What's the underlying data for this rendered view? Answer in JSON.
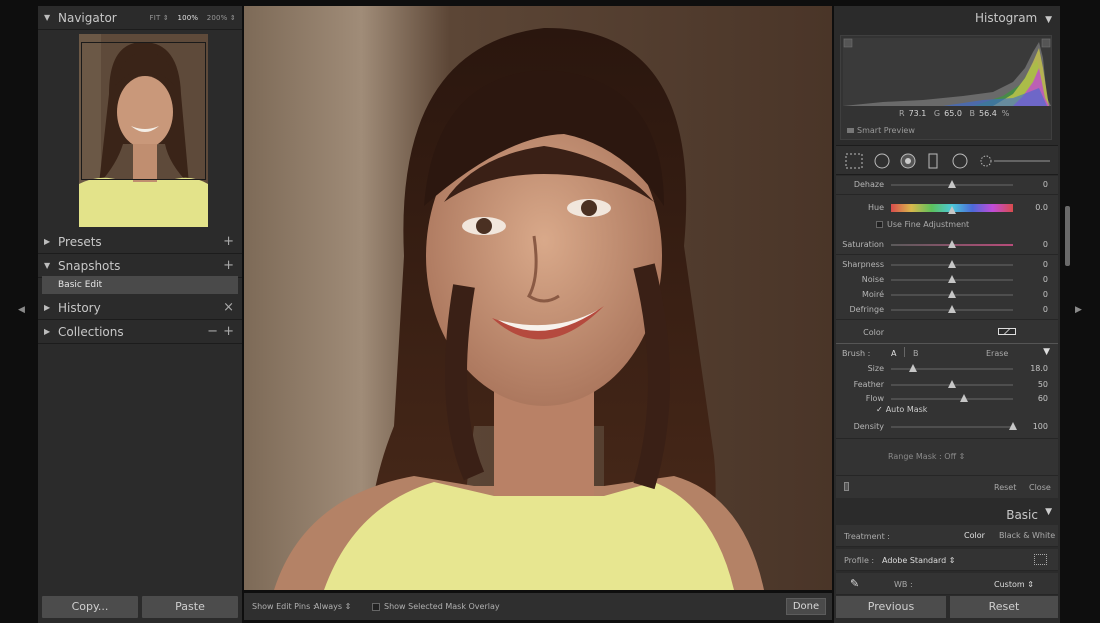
{
  "left_panel": {
    "navigator": {
      "title": "Navigator",
      "zoom_fit": "FIT ⇕",
      "zoom_100": "100%",
      "zoom_200": "200% ⇕"
    },
    "presets": {
      "title": "Presets"
    },
    "snapshots": {
      "title": "Snapshots",
      "item": "Basic Edit"
    },
    "history": {
      "title": "History"
    },
    "collections": {
      "title": "Collections"
    },
    "copy_label": "Copy...",
    "paste_label": "Paste"
  },
  "toolbar": {
    "edit_pins_label": "Show Edit Pins :",
    "edit_pins_value": "Always ⇕",
    "mask_overlay_label": "Show Selected Mask Overlay",
    "done_label": "Done"
  },
  "histogram": {
    "title": "Histogram",
    "r_label": "R",
    "r_value": "73.1",
    "g_label": "G",
    "g_value": "65.0",
    "b_label": "B",
    "b_value": "56.4",
    "unit": "%",
    "smart_preview": "Smart Preview"
  },
  "mask": {
    "dehaze": {
      "label": "Dehaze",
      "value": "0",
      "level": 0.5
    },
    "hue": {
      "label": "Hue",
      "value": "0.0",
      "level": 0.5
    },
    "fine_adjust": "Use Fine Adjustment",
    "saturation": {
      "label": "Saturation",
      "value": "0",
      "level": 0.5
    },
    "sharpness": {
      "label": "Sharpness",
      "value": "0",
      "level": 0.5
    },
    "noise": {
      "label": "Noise",
      "value": "0",
      "level": 0.5
    },
    "moire": {
      "label": "Moiré",
      "value": "0",
      "level": 0.5
    },
    "defringe": {
      "label": "Defringe",
      "value": "0",
      "level": 0.5
    },
    "color_label": "Color",
    "brush_label": "Brush :",
    "brush_a": "A",
    "brush_b": "B",
    "erase": "Erase",
    "size": {
      "label": "Size",
      "value": "18.0",
      "level": 0.18
    },
    "feather": {
      "label": "Feather",
      "value": "50",
      "level": 0.5
    },
    "flow": {
      "label": "Flow",
      "value": "60",
      "level": 0.6
    },
    "auto_mask": "Auto Mask",
    "density": {
      "label": "Density",
      "value": "100",
      "level": 1.0
    },
    "range_mask": "Range Mask : Off ⇕",
    "reset": "Reset",
    "close": "Close"
  },
  "basic": {
    "title": "Basic",
    "treatment_label": "Treatment :",
    "treatment_color": "Color",
    "treatment_bw": "Black & White",
    "profile_label": "Profile :",
    "profile_value": "Adobe Standard ⇕",
    "wb_label": "WB :",
    "wb_value": "Custom ⇕"
  },
  "bottom": {
    "previous_label": "Previous",
    "reset_label": "Reset"
  },
  "colors": {
    "panel_bg": "#2b2b2b",
    "window_bg": "#0e0e0e",
    "button_bg": "#4c4c4c"
  }
}
